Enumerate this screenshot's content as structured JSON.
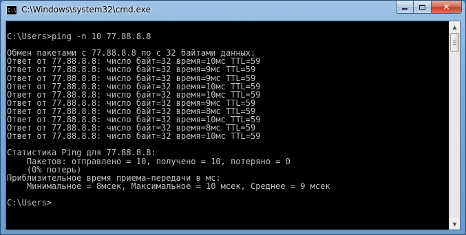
{
  "window": {
    "title": "C:\\Windows\\system32\\cmd.exe",
    "icon_label": "C:\\",
    "buttons": {
      "minimize": "minimize",
      "maximize": "maximize",
      "close": "✕"
    }
  },
  "console": {
    "lines": [
      "",
      "C:\\Users>ping -n 10 77.88.8.8",
      "",
      "Обмен пакетами с 77.88.8.8 по с 32 байтами данных:",
      "Ответ от 77.88.8.8: число байт=32 время=10мс TTL=59",
      "Ответ от 77.88.8.8: число байт=32 время=9мс TTL=59",
      "Ответ от 77.88.8.8: число байт=32 время=9мс TTL=59",
      "Ответ от 77.88.8.8: число байт=32 время=10мс TTL=59",
      "Ответ от 77.88.8.8: число байт=32 время=10мс TTL=59",
      "Ответ от 77.88.8.8: число байт=32 время=9мс TTL=59",
      "Ответ от 77.88.8.8: число байт=32 время=8мс TTL=59",
      "Ответ от 77.88.8.8: число байт=32 время=10мс TTL=59",
      "Ответ от 77.88.8.8: число байт=32 время=8мс TTL=59",
      "Ответ от 77.88.8.8: число байт=32 время=10мс TTL=59",
      "",
      "Статистика Ping для 77.88.8.8:",
      "    Пакетов: отправлено = 10, получено = 10, потеряно = 0",
      "    (0% потерь)",
      "Приблизительное время приема-передачи в мс:",
      "    Минимальное = 8мсек, Максимальное = 10 мсек, Среднее = 9 мсек",
      "",
      "C:\\Users>"
    ]
  },
  "scrollbar": {
    "position_fraction": 0.0,
    "visible_fraction": 0.1
  },
  "colors": {
    "console_bg": "#000000",
    "console_fg": "#c0c0c0",
    "close_button": "#c2432a"
  }
}
